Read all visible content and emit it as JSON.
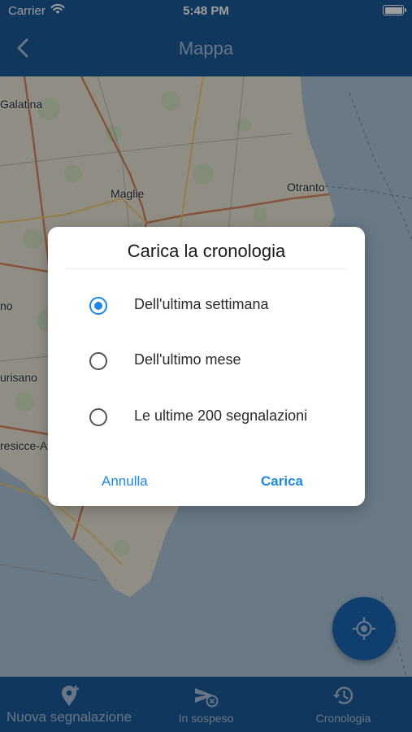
{
  "status_bar": {
    "carrier": "Carrier",
    "time": "5:48 PM"
  },
  "nav": {
    "title": "Mappa",
    "back_icon": "chevron-left-icon"
  },
  "map": {
    "places": [
      "Galatina",
      "Maglie",
      "Otranto",
      "no",
      "urisano",
      "resicce-A"
    ]
  },
  "dialog": {
    "title": "Carica la cronologia",
    "options": [
      {
        "label": "Dell'ultima settimana",
        "selected": true
      },
      {
        "label": "Dell'ultimo mese",
        "selected": false
      },
      {
        "label": "Le ultime 200 segnalazioni",
        "selected": false
      }
    ],
    "cancel_label": "Annulla",
    "confirm_label": "Carica"
  },
  "fab": {
    "icon": "my-location-icon"
  },
  "tabs": [
    {
      "label": "Nuova segnalazione",
      "icon": "add-location-icon"
    },
    {
      "label": "In sospeso",
      "icon": "pending-send-icon"
    },
    {
      "label": "Cronologia",
      "icon": "history-icon"
    }
  ],
  "colors": {
    "primary": "#1b5a96",
    "accent": "#1e88e5",
    "tab_text": "#a8bfdc"
  }
}
